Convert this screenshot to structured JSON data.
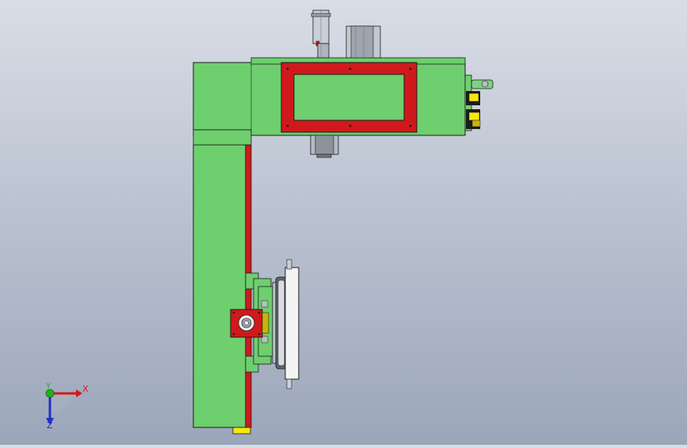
{
  "viewport": {
    "background_top": "#d9dde6",
    "background_bottom": "#9ba6b9"
  },
  "model": {
    "body_color": "#6ecf6e",
    "frame_color": "#d0191c",
    "accent_yellow": "#f4e80c",
    "metal_color": "#b8bec6"
  },
  "triad": {
    "x_label": "X",
    "y_label": "Y",
    "z_label": "Z",
    "x_color": "#d21a1a",
    "y_color": "#20b020",
    "z_color": "#2030c8"
  }
}
